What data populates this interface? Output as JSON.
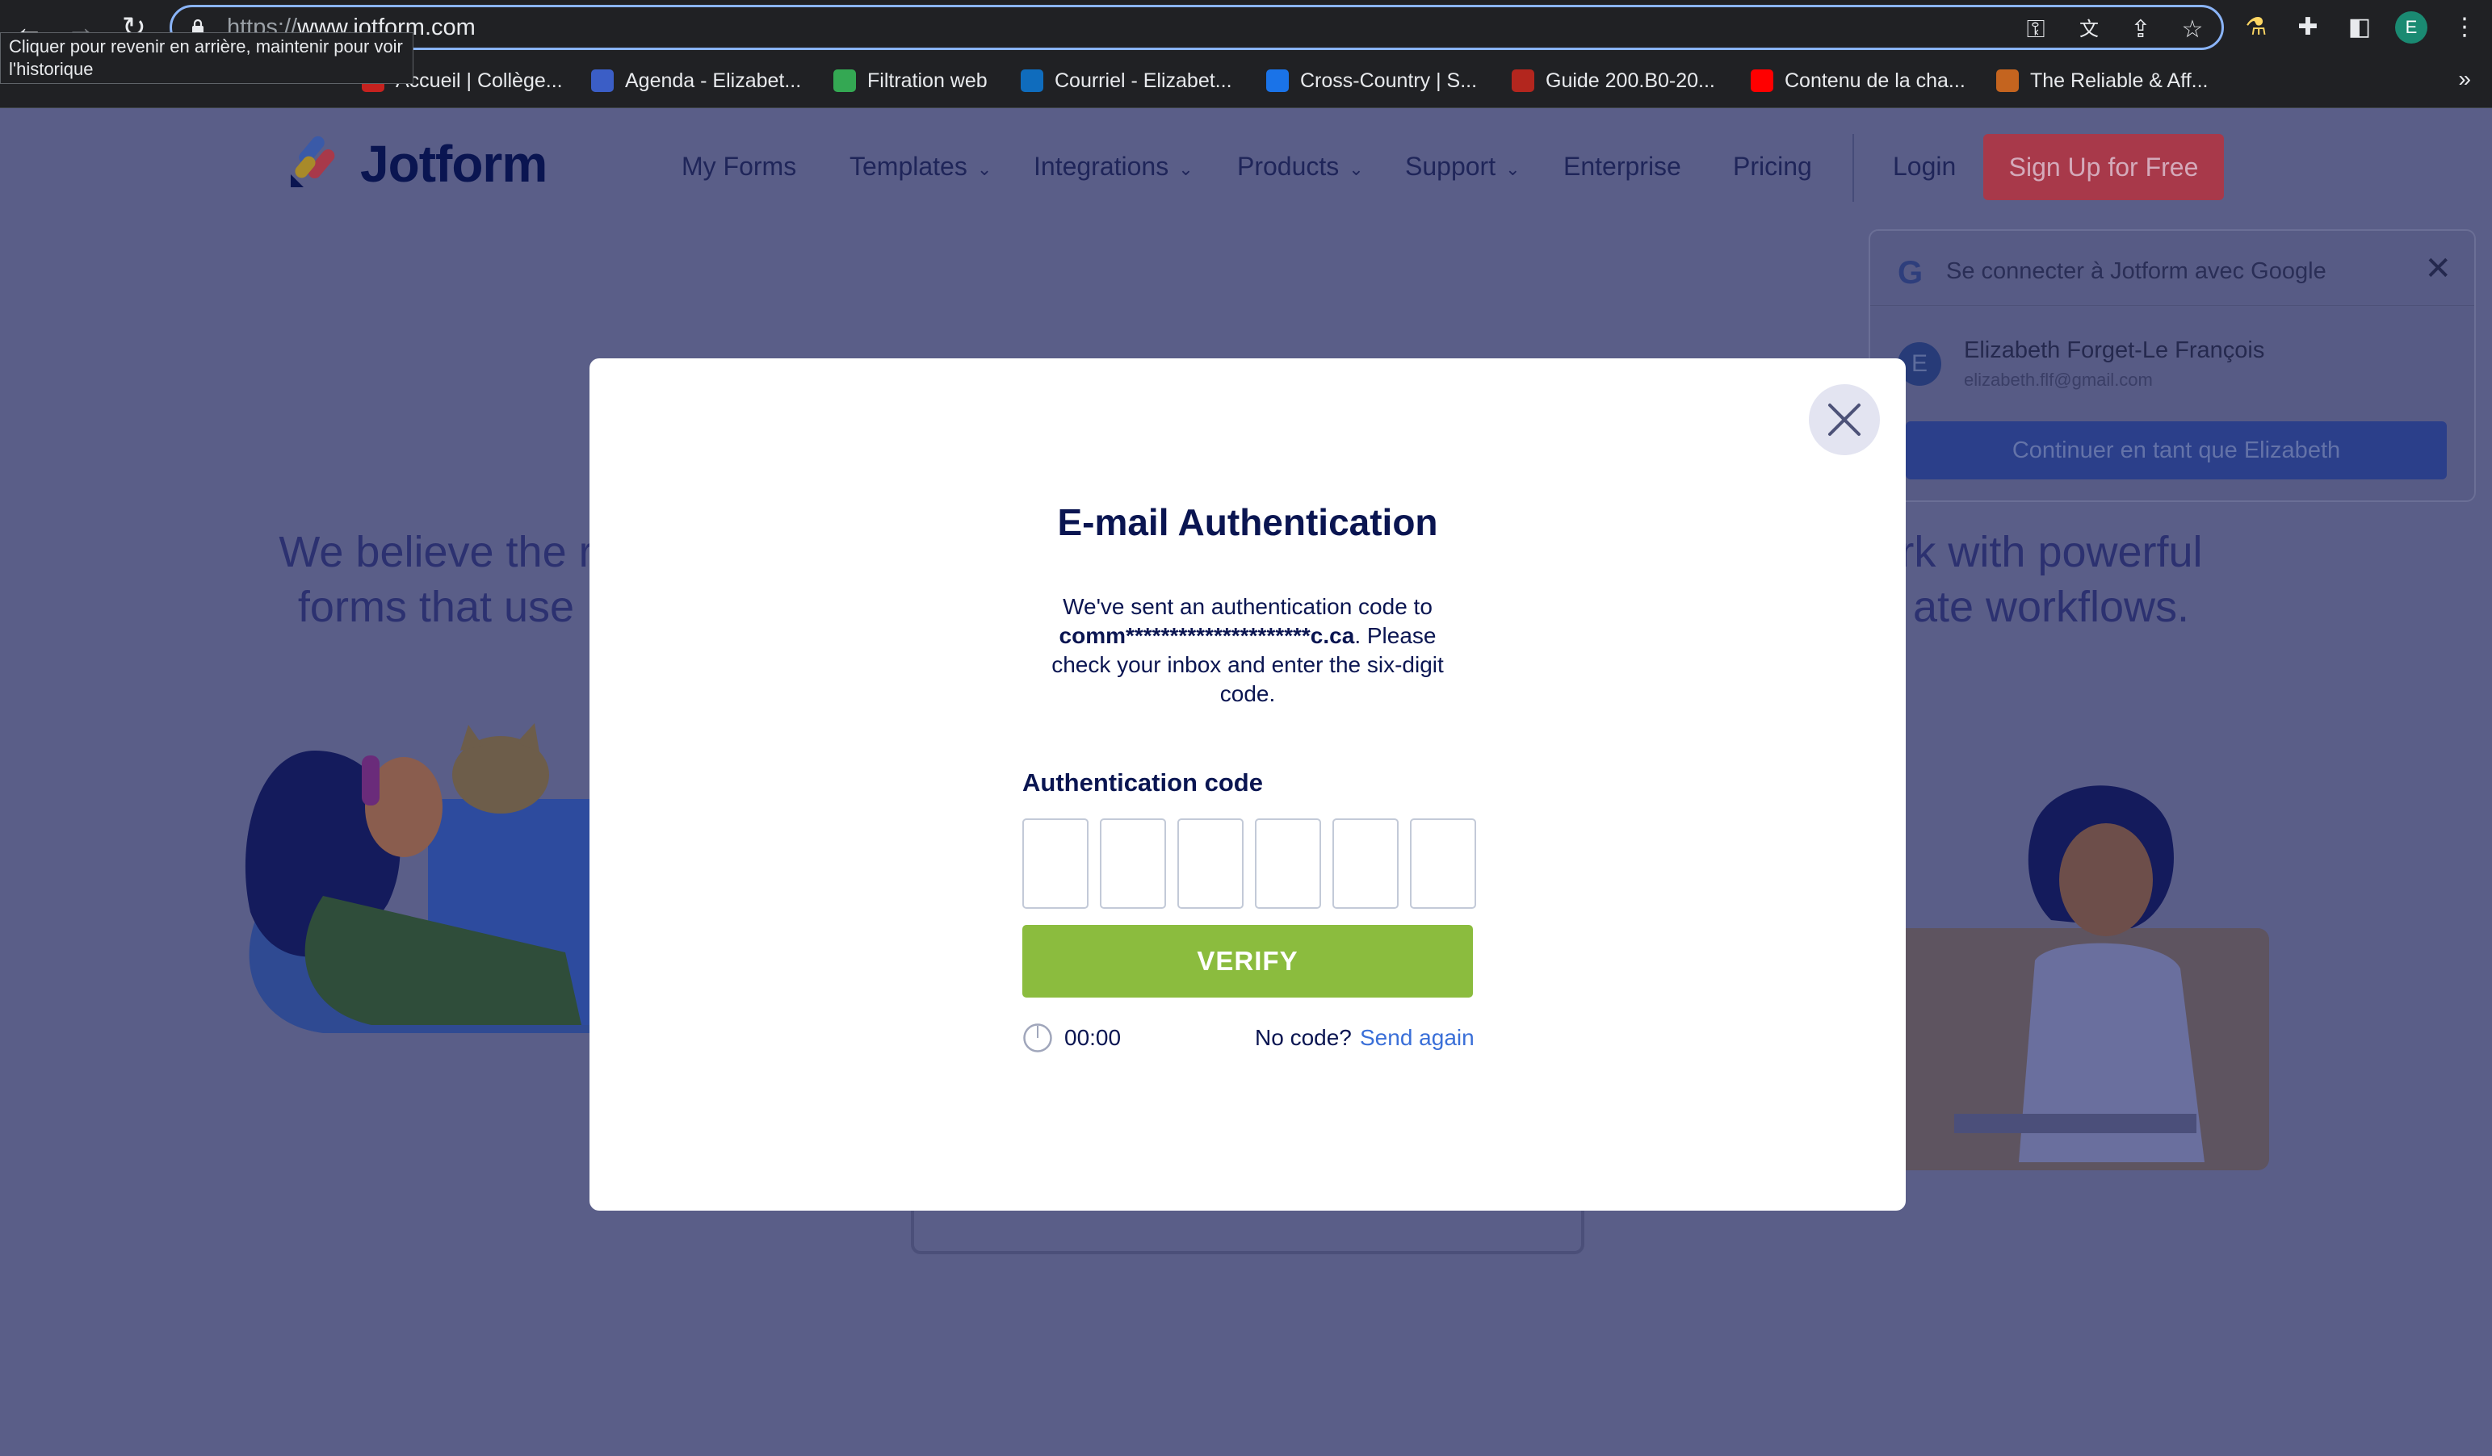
{
  "browser": {
    "url_scheme": "https://",
    "url_host": "www.jotform.com",
    "back_tooltip": "Cliquer pour revenir en arrière, maintenir pour voir l'historique",
    "profile_initial": "E",
    "bookmarks_overflow": "»",
    "bookmarks": [
      {
        "label": "Accueil | Collège...",
        "color": "#c5221f"
      },
      {
        "label": "Agenda - Elizabet...",
        "color": "#3b5ec6"
      },
      {
        "label": "Filtration web",
        "color": "#34a853"
      },
      {
        "label": "Courriel - Elizabet...",
        "color": "#0f6cbd"
      },
      {
        "label": "Cross-Country | S...",
        "color": "#1a73e8"
      },
      {
        "label": "Guide 200.B0-20...",
        "color": "#b3261e"
      },
      {
        "label": "Contenu de la cha...",
        "color": "#ff0000"
      },
      {
        "label": "The Reliable & Aff...",
        "color": "#c4641f"
      }
    ]
  },
  "site": {
    "logo_text": "Jotform",
    "nav": [
      "My Forms",
      "Templates",
      "Integrations",
      "Products",
      "Support",
      "Enterprise",
      "Pricing"
    ],
    "login": "Login",
    "signup": "Sign Up for Free",
    "hero_left": [
      "We believe the r",
      "forms that use"
    ],
    "hero_right": [
      "rk with powerful",
      "ate workflows."
    ]
  },
  "google_prompt": {
    "title": "Se connecter à Jotform avec Google",
    "avatar_initial": "E",
    "name": "Elizabeth Forget-Le François",
    "email": "elizabeth.flf@gmail.com",
    "continue_label": "Continuer en tant que Elizabeth"
  },
  "modal": {
    "title": "E-mail Authentication",
    "desc_prefix": "We've sent an authentication code to",
    "desc_email": "comm*********************c.ca",
    "desc_suffix": ". Please check your inbox and enter the six-digit code.",
    "code_label": "Authentication code",
    "code_digits": [
      "",
      "",
      "",
      "",
      "",
      ""
    ],
    "verify_label": "VERIFY",
    "timer": "00:00",
    "no_code": "No code?",
    "send_again": "Send again"
  },
  "colors": {
    "overlay": "#5a5e88",
    "verify_green": "#8bbc3e",
    "link_blue": "#3a6fd8",
    "navy": "#0a1551"
  }
}
